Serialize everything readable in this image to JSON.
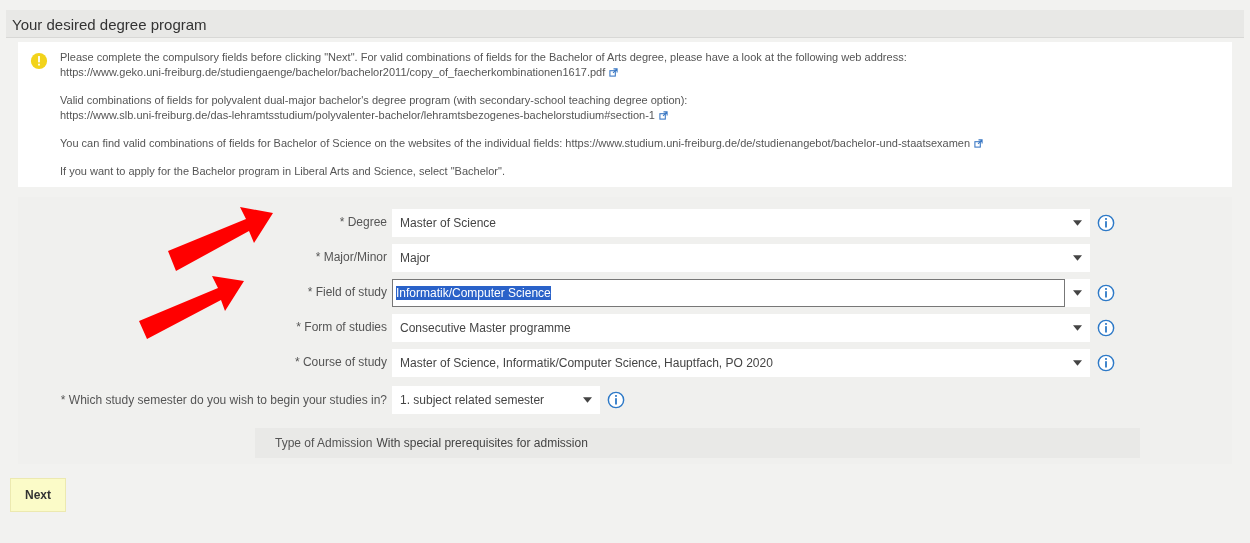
{
  "section": {
    "title": "Your desired degree program"
  },
  "notice": {
    "paragraphs": [
      {
        "text": "Please complete the compulsory fields before clicking \"Next\". For valid combinations of fields for the Bachelor of Arts degree, please have a look at the following web address: ",
        "link": "https://www.geko.uni-freiburg.de/studiengaenge/bachelor/bachelor2011/copy_of_faecherkombinationen1617.pdf"
      },
      {
        "text": "Valid combinations of fields for polyvalent dual-major bachelor's degree program (with secondary-school teaching degree option):",
        "link": "https://www.slb.uni-freiburg.de/das-lehramtsstudium/polyvalenter-bachelor/lehramtsbezogenes-bachelorstudium#section-1"
      },
      {
        "text": "You can find valid combinations of fields for Bachelor of Science on the websites of the individual fields: ",
        "link": "https://www.studium.uni-freiburg.de/de/studienangebot/bachelor-und-staatsexamen"
      },
      {
        "text": "If you want to apply for the Bachelor program in Liberal Arts and Science, select \"Bachelor\"."
      }
    ]
  },
  "fields": [
    {
      "label": "* Degree",
      "value": "Master of Science",
      "kind": "select",
      "info": true,
      "focused": false
    },
    {
      "label": "* Major/Minor",
      "value": "Major",
      "kind": "select",
      "info": false,
      "focused": false
    },
    {
      "label": "* Field of study",
      "value": "Informatik/Computer Science",
      "kind": "combo",
      "info": true,
      "focused": true
    },
    {
      "label": "* Form of studies",
      "value": "Consecutive Master programme",
      "kind": "select",
      "info": true,
      "focused": false
    },
    {
      "label": "* Course of study",
      "value": "Master of Science, Informatik/Computer Science, Hauptfach, PO 2020",
      "kind": "select",
      "info": true,
      "focused": false
    },
    {
      "label": "* Which study semester do you wish to begin your studies in?",
      "value": "1. subject related semester",
      "kind": "short-select",
      "info": true,
      "focused": false
    }
  ],
  "admission": {
    "label": "Type of Admission",
    "value": "With special prerequisites for admission"
  },
  "buttons": [
    {
      "label": "Next"
    }
  ]
}
